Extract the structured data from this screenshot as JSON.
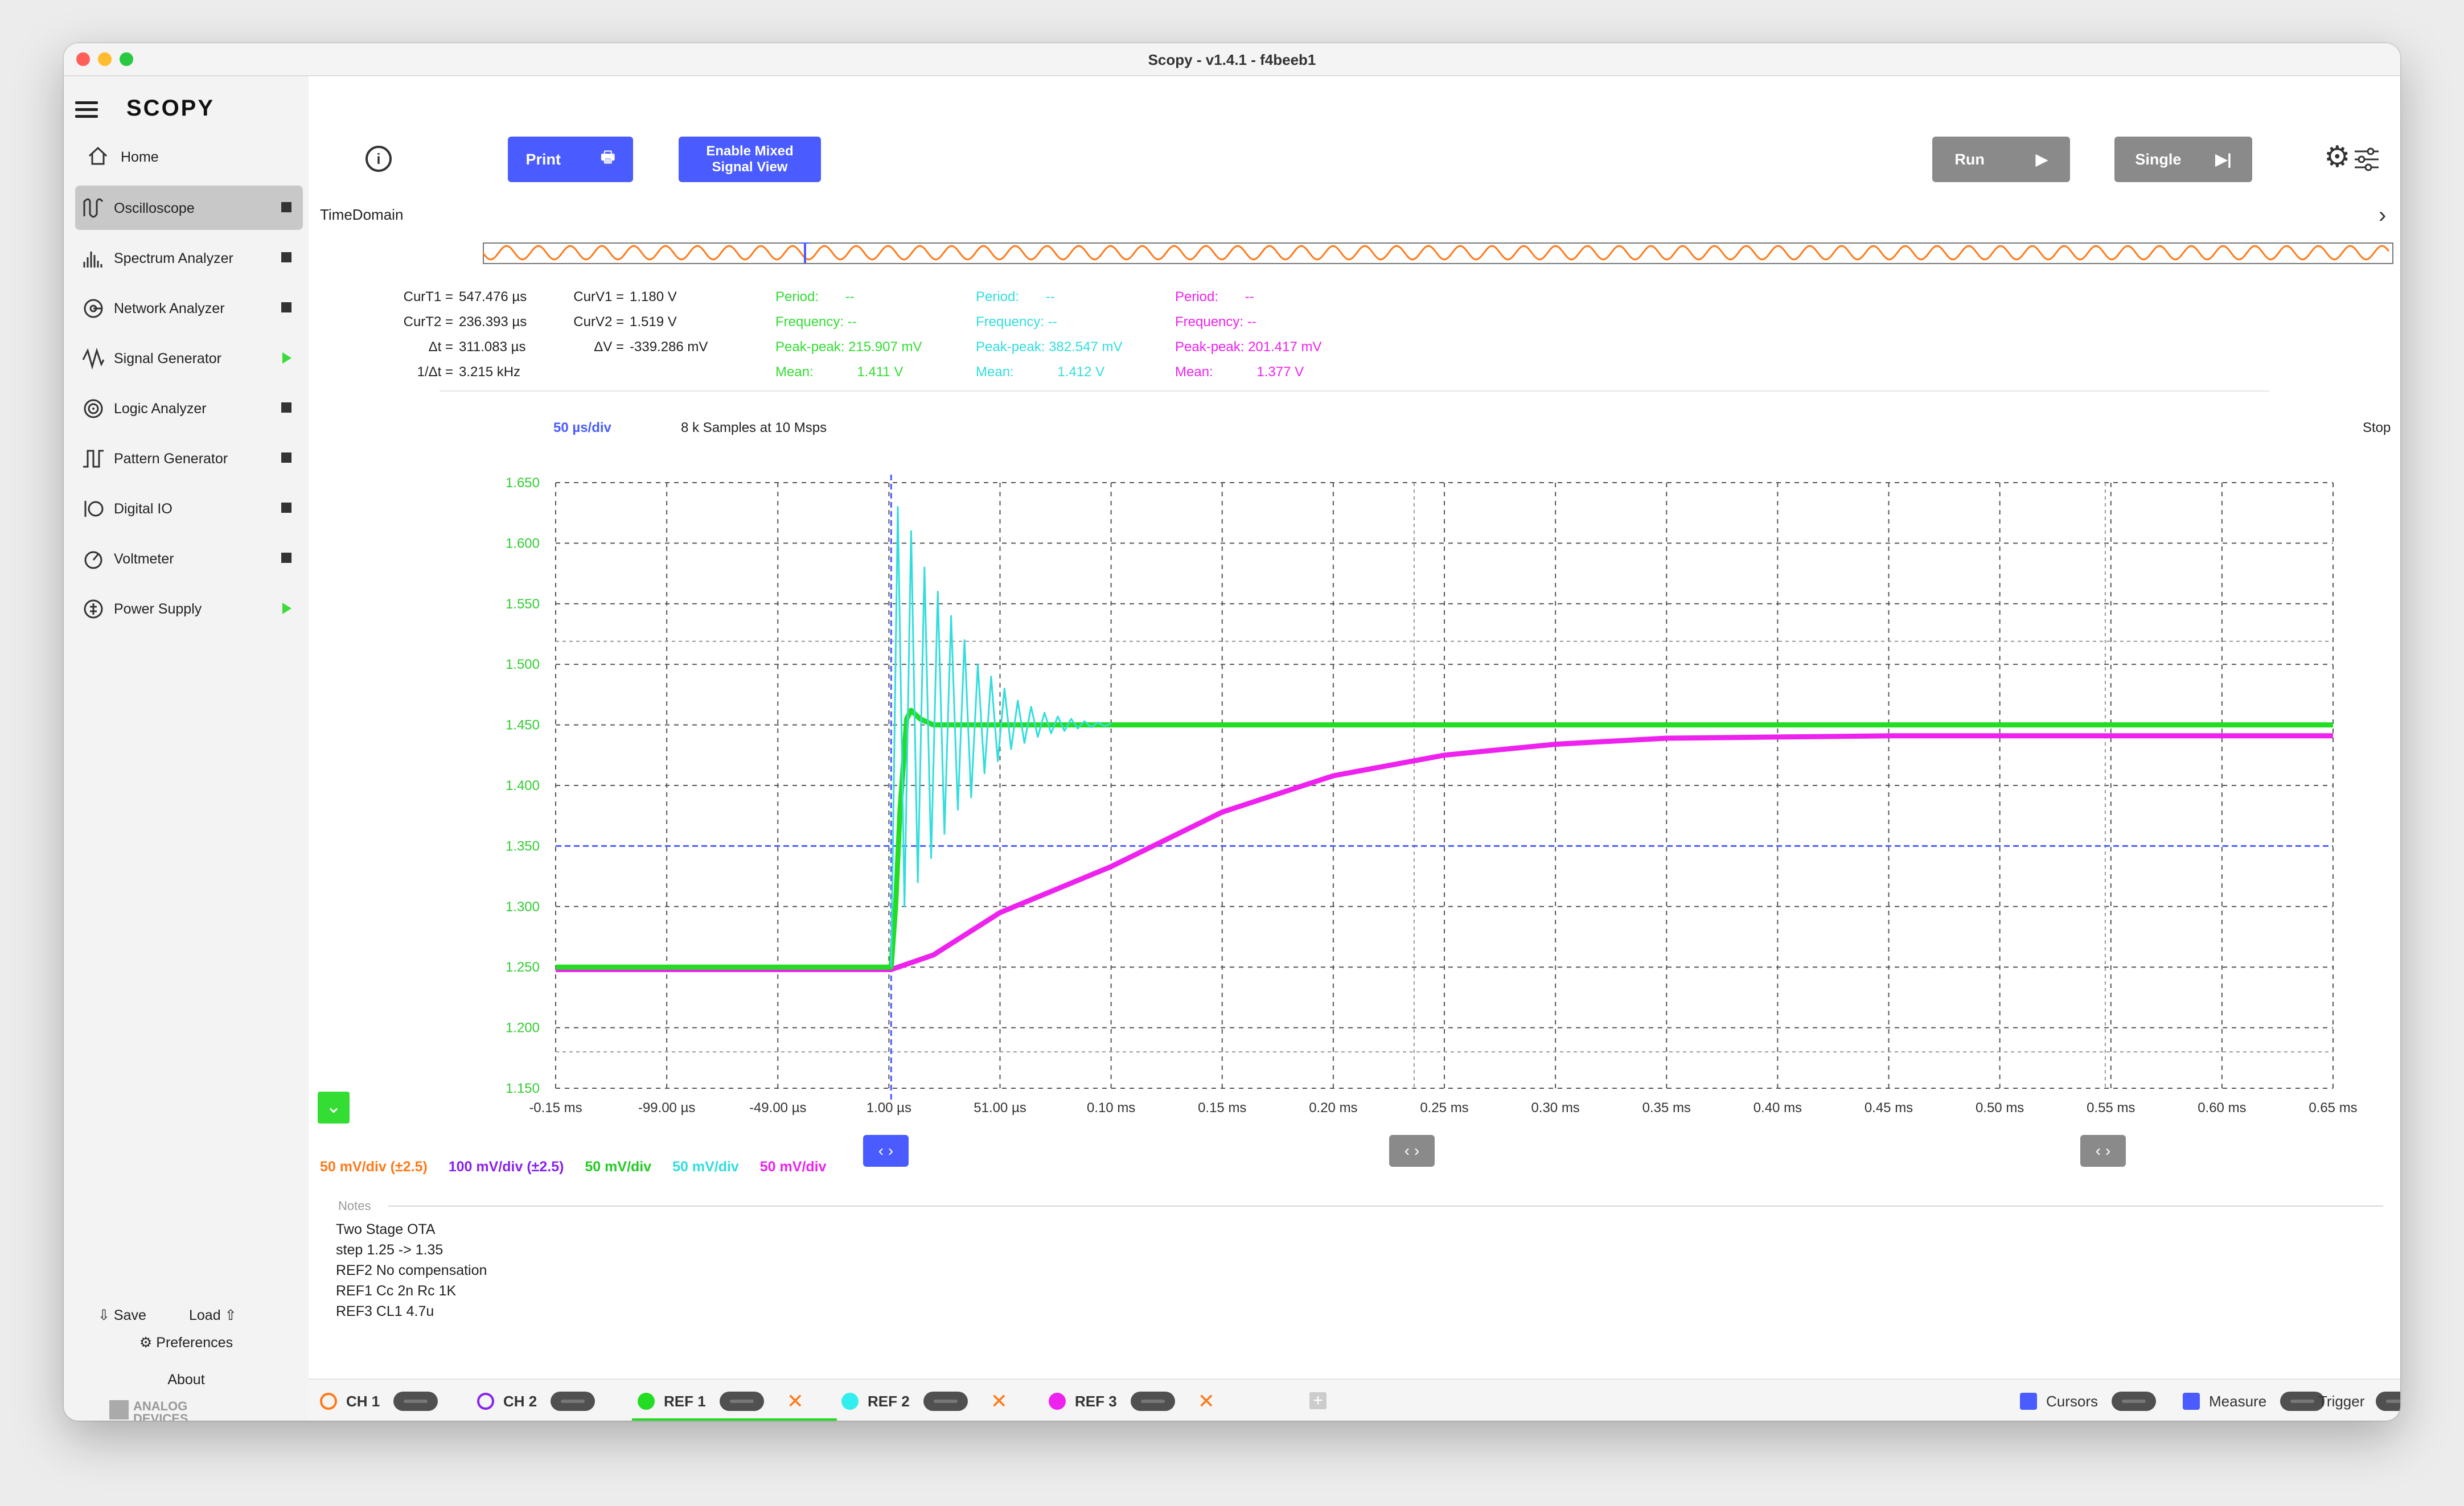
{
  "app": {
    "title": "Scopy - v1.4.1 - f4beeb1",
    "brand": "SCOPY",
    "vendor": "ANALOG DEVICES"
  },
  "sidebar": {
    "home": "Home",
    "items": [
      {
        "label": "Oscilloscope",
        "icon": "oscilloscope-icon",
        "state": "square",
        "active": true
      },
      {
        "label": "Spectrum Analyzer",
        "icon": "spectrum-icon",
        "state": "square"
      },
      {
        "label": "Network Analyzer",
        "icon": "network-icon",
        "state": "square"
      },
      {
        "label": "Signal Generator",
        "icon": "signal-gen-icon",
        "state": "play"
      },
      {
        "label": "Logic Analyzer",
        "icon": "logic-icon",
        "state": "square"
      },
      {
        "label": "Pattern Generator",
        "icon": "pattern-icon",
        "state": "square"
      },
      {
        "label": "Digital IO",
        "icon": "digital-io-icon",
        "state": "square"
      },
      {
        "label": "Voltmeter",
        "icon": "voltmeter-icon",
        "state": "square"
      },
      {
        "label": "Power Supply",
        "icon": "power-icon",
        "state": "play"
      }
    ],
    "save": "Save",
    "load": "Load",
    "preferences": "Preferences",
    "about": "About"
  },
  "toolbar": {
    "print": "Print",
    "mixed_line1": "Enable Mixed",
    "mixed_line2": "Signal View",
    "run": "Run",
    "single": "Single"
  },
  "time_domain_label": "TimeDomain",
  "cursor_readouts": {
    "curT1_label": "CurT1 =",
    "curT1": "547.476 µs",
    "curT2_label": "CurT2 =",
    "curT2": "236.393 µs",
    "dt_label": "Δt =",
    "dt": "311.083 µs",
    "inv_dt_label": "1/Δt =",
    "inv_dt": "3.215 kHz",
    "curV1_label": "CurV1 =",
    "curV1": "1.180 V",
    "curV2_label": "CurV2 =",
    "curV2": "1.519 V",
    "dv_label": "ΔV =",
    "dv": "-339.286 mV"
  },
  "measurements": [
    {
      "color": "#33dd33",
      "period_label": "Period:",
      "period": "--",
      "freq_label": "Frequency:",
      "freq": "--",
      "pp_label": "Peak-peak:",
      "pp": "215.907 mV",
      "mean_label": "Mean:",
      "mean": "1.411 V"
    },
    {
      "color": "#33dddd",
      "period_label": "Period:",
      "period": "--",
      "freq_label": "Frequency:",
      "freq": "--",
      "pp_label": "Peak-peak:",
      "pp": "382.547 mV",
      "mean_label": "Mean:",
      "mean": "1.412 V"
    },
    {
      "color": "#ee22ee",
      "period_label": "Period:",
      "period": "--",
      "freq_label": "Frequency:",
      "freq": "--",
      "pp_label": "Peak-peak:",
      "pp": "201.417 mV",
      "mean_label": "Mean:",
      "mean": "1.377 V"
    }
  ],
  "plot_header": {
    "timebase": "50 µs/div",
    "samples": "8 k Samples at 10 Msps",
    "status": "Stop"
  },
  "chart_data": {
    "type": "line",
    "title": "",
    "xlabel": "",
    "ylabel": "",
    "xlim_us": [
      -150,
      650
    ],
    "ylim": [
      1.15,
      1.65
    ],
    "x_tick_labels": [
      "-0.15 ms",
      "-99.00 µs",
      "-49.00 µs",
      "1.00 µs",
      "51.00 µs",
      "0.10 ms",
      "0.15 ms",
      "0.20 ms",
      "0.25 ms",
      "0.30 ms",
      "0.35 ms",
      "0.40 ms",
      "0.45 ms",
      "0.50 ms",
      "0.55 ms",
      "0.60 ms",
      "0.65 ms"
    ],
    "y_tick_labels": [
      "1.650",
      "1.600",
      "1.550",
      "1.500",
      "1.450",
      "1.400",
      "1.350",
      "1.300",
      "1.250",
      "1.200",
      "1.150"
    ],
    "grid": true,
    "trigger_level": 1.35,
    "trigger_time_us": 1,
    "cursor_times_us": [
      236.393,
      547.476
    ],
    "cursor_levels": [
      1.519,
      1.18
    ],
    "series": [
      {
        "name": "REF 1",
        "color": "#22dd22",
        "x": [
          -150,
          -10,
          0,
          1,
          3,
          5,
          7,
          8,
          10,
          14,
          20,
          40,
          100,
          300,
          650
        ],
        "y": [
          1.25,
          1.25,
          1.25,
          1.25,
          1.3,
          1.38,
          1.43,
          1.455,
          1.462,
          1.455,
          1.45,
          1.45,
          1.45,
          1.45,
          1.45
        ]
      },
      {
        "name": "REF 2",
        "color": "#33dddd",
        "x": [
          1,
          4,
          7,
          10,
          13,
          16,
          19,
          22,
          25,
          28,
          31,
          34,
          37,
          40,
          43,
          46,
          49,
          52,
          55,
          58,
          61,
          64,
          67,
          70,
          73,
          76,
          79,
          82,
          85,
          88,
          91,
          94,
          97,
          100
        ],
        "y": [
          1.25,
          1.63,
          1.3,
          1.61,
          1.32,
          1.58,
          1.34,
          1.56,
          1.36,
          1.54,
          1.38,
          1.52,
          1.39,
          1.5,
          1.41,
          1.49,
          1.42,
          1.48,
          1.43,
          1.47,
          1.435,
          1.465,
          1.44,
          1.46,
          1.443,
          1.457,
          1.445,
          1.455,
          1.447,
          1.453,
          1.448,
          1.452,
          1.449,
          1.451
        ]
      },
      {
        "name": "REF 3",
        "color": "#ee22ee",
        "x": [
          -150,
          0,
          1,
          20,
          50,
          100,
          150,
          200,
          250,
          300,
          350,
          400,
          450,
          500,
          550,
          600,
          650
        ],
        "y": [
          1.248,
          1.248,
          1.248,
          1.26,
          1.295,
          1.333,
          1.378,
          1.408,
          1.425,
          1.434,
          1.439,
          1.44,
          1.441,
          1.441,
          1.441,
          1.441,
          1.441
        ]
      }
    ]
  },
  "scales": [
    {
      "label": "50 mV/div (±2.5)",
      "color": "#ff7a1a"
    },
    {
      "label": "100 mV/div (±2.5)",
      "color": "#8822ee"
    },
    {
      "label": "50 mV/div",
      "color": "#22cc22"
    },
    {
      "label": "50 mV/div",
      "color": "#33dddd"
    },
    {
      "label": "50 mV/div",
      "color": "#ee22ee"
    }
  ],
  "notes_label": "Notes",
  "notes": [
    "Two Stage OTA",
    "step 1.25 -> 1.35",
    "REF2 No compensation",
    "REF1 Cc 2n Rc 1K",
    "REF3 CL1 4.7u"
  ],
  "channels": [
    {
      "label": "CH 1",
      "color": "#ff7a1a",
      "filled": false,
      "closable": false
    },
    {
      "label": "CH 2",
      "color": "#8822ee",
      "filled": false,
      "closable": false
    },
    {
      "label": "REF 1",
      "color": "#22dd22",
      "filled": true,
      "closable": true
    },
    {
      "label": "REF 2",
      "color": "#33dddd",
      "filled": true,
      "closable": true
    },
    {
      "label": "REF 3",
      "color": "#ee22ee",
      "filled": true,
      "closable": true
    }
  ],
  "bottom_right": {
    "cursors": "Cursors",
    "measure": "Measure",
    "trigger": "Trigger"
  },
  "colors": {
    "accent": "#4a5cff",
    "grey_button": "#8a8a8a"
  }
}
